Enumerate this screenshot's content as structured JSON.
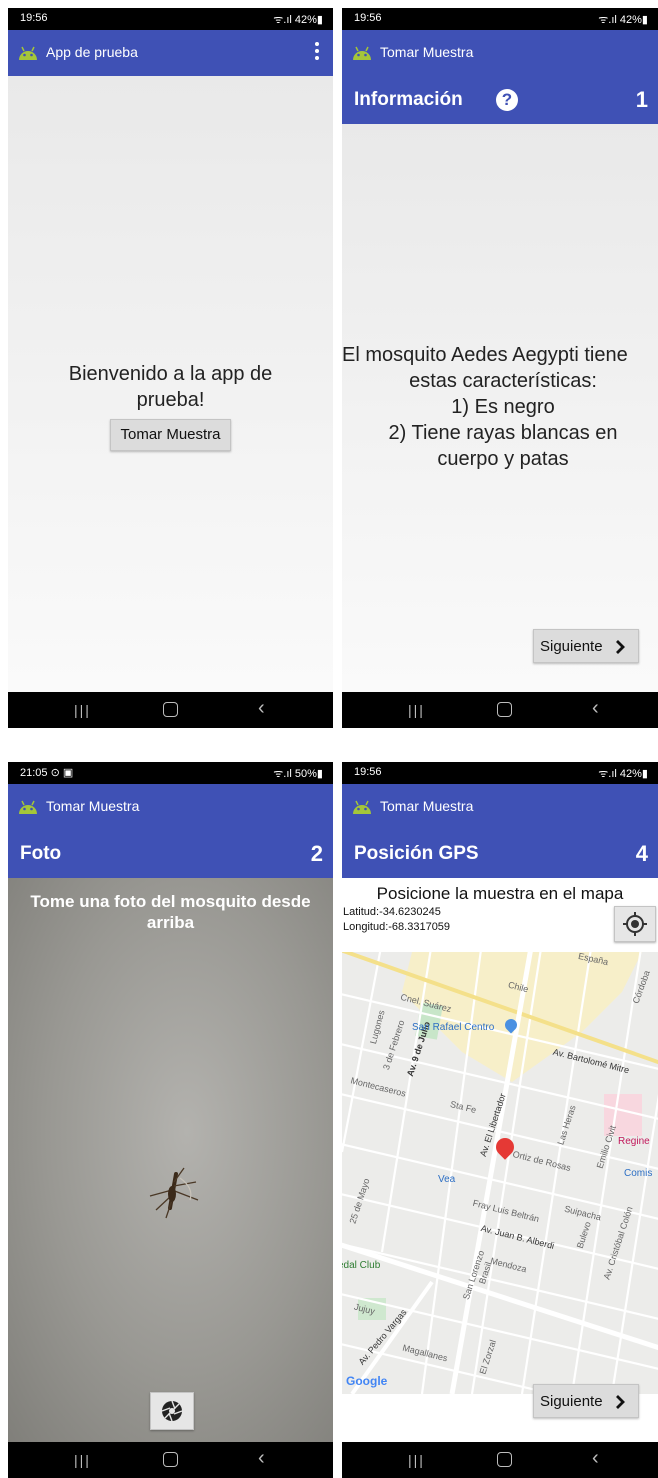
{
  "screen1": {
    "status": {
      "time": "19:56",
      "indicators": "ᯤ.ıl 42%▮"
    },
    "appbar": {
      "title": "App de prueba"
    },
    "welcome_text": "Bienvenido a la app de prueba!",
    "button_label": "Tomar Muestra"
  },
  "screen2": {
    "status": {
      "time": "19:56",
      "indicators": "ᯤ.ıl 42%▮"
    },
    "appbar": {
      "title": "Tomar Muestra"
    },
    "header": {
      "title": "Información",
      "help_icon": "?",
      "step": "1"
    },
    "info_lines": [
      "El mosquito Aedes Aegypti tiene",
      "estas características:",
      "1) Es negro",
      "2) Tiene rayas blancas en",
      "cuerpo y patas"
    ],
    "next_label": "Siguiente"
  },
  "screen3": {
    "status": {
      "time": "21:05 ⊙ ▣",
      "indicators": "ᯤ.ıl 50%▮"
    },
    "appbar": {
      "title": "Tomar Muestra"
    },
    "header": {
      "title": "Foto",
      "step": "2"
    },
    "instruction": "Tome una foto del mosquito desde arriba"
  },
  "screen4": {
    "status": {
      "time": "19:56",
      "indicators": "ᯤ.ıl 42%▮"
    },
    "appbar": {
      "title": "Tomar Muestra"
    },
    "header": {
      "title": "Posición GPS",
      "step": "4"
    },
    "instruction": "Posicione la muestra en el mapa",
    "latitude": "Latitud:-34.6230245",
    "longitude": "Longitud:-68.3317059",
    "map_labels": {
      "chile": "Chile",
      "espana": "España",
      "cordoba": "Córdoba",
      "san_rafael_centro": "San Rafael Centro",
      "bartolome_mitre": "Av. Bartolomé Mitre",
      "nueve_de_julio": "Av. 9 de Julio",
      "tres_de_febrero": "3 de Febrero",
      "cnel_suarez": "Cnel. Suárez",
      "lugones": "Lugones",
      "montecaseros": "Montecaseros",
      "sta_fe": "Sta Fe",
      "el_libertador": "Av. El Libertador",
      "ortiz_de_rosas": "Ortiz de Rosas",
      "las_heras": "Las Heras",
      "emilio_civit": "Emilio Civit",
      "regine": "Regine",
      "comis": "Comis",
      "vea": "Vea",
      "fray_luis_beltran": "Fray Luis Beltrán",
      "suipacha": "Suipacha",
      "juan_b_alberdi": "Av. Juan B. Alberdi",
      "mendoza": "Mendoza",
      "brasil": "Brasil",
      "san_lorenzo": "San Lorenzo",
      "buljevo": "Bulevo",
      "cristobal_colon": "Av. Cristóbal Colón",
      "veinticinco_de_mayo": "25 de Mayo",
      "dal_club": "edal Club",
      "jujuy": "Jujuy",
      "pedro_vargas": "Av. Pedro Vargas",
      "magallanes": "Magallanes",
      "el_zorzal": "El Zorzal",
      "google": "Google"
    },
    "next_label": "Siguiente"
  }
}
